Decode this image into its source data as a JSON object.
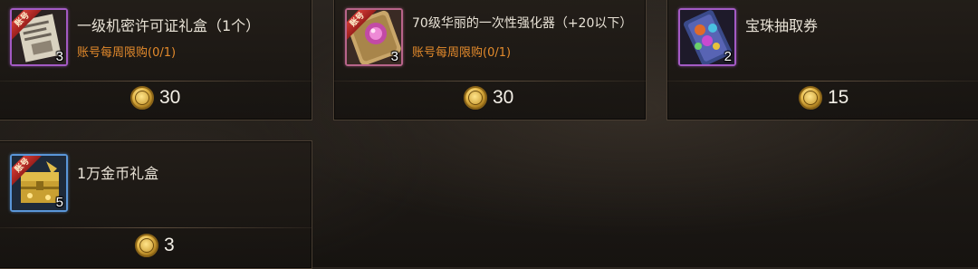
{
  "items": [
    {
      "name": "一级机密许可证礼盒（1个）",
      "limit": "账号每周限购(0/1)",
      "quantity": "3",
      "price": "30",
      "icon": "secret-document-icon",
      "badge": "账号"
    },
    {
      "name": "70级华丽的一次性强化器（+20以下）",
      "limit": "账号每周限购(0/1)",
      "quantity": "3",
      "price": "30",
      "icon": "enhancer-scroll-icon",
      "badge": "账号"
    },
    {
      "name": "宝珠抽取券",
      "limit": "",
      "quantity": "2",
      "price": "15",
      "icon": "orb-ticket-icon",
      "badge": ""
    },
    {
      "name": "1万金币礼盒",
      "limit": "",
      "quantity": "5",
      "price": "3",
      "icon": "gold-chest-icon",
      "badge": "账号"
    }
  ],
  "colors": {
    "limit_text": "#e38a2c",
    "slot_purple": "#a35ac4",
    "slot_blue": "#5a96d8"
  }
}
